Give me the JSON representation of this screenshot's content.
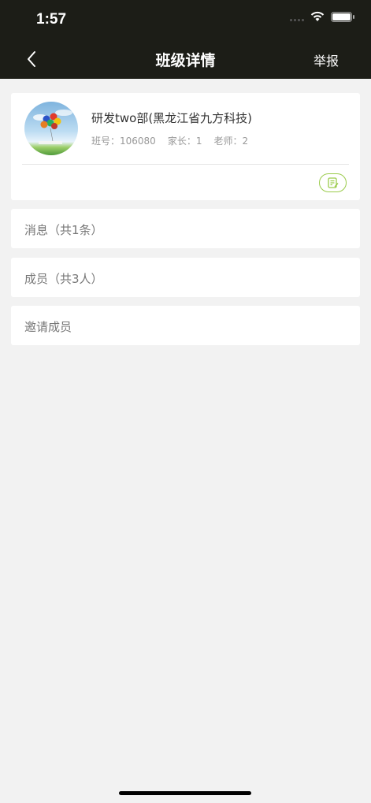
{
  "status_bar": {
    "time": "1:57"
  },
  "nav": {
    "title": "班级详情",
    "report_label": "举报"
  },
  "class_info": {
    "name": "研发two部(黑龙江省九方科技)",
    "class_no": "班号：106080",
    "parents": "家长：1",
    "teachers": "老师：2"
  },
  "rows": {
    "messages": "消息（共1条）",
    "members": "成员（共3人）",
    "invite": "邀请成员"
  },
  "colors": {
    "header_bg": "#1c1d17",
    "page_bg": "#f2f2f2",
    "accent_green": "#9acb4a"
  }
}
